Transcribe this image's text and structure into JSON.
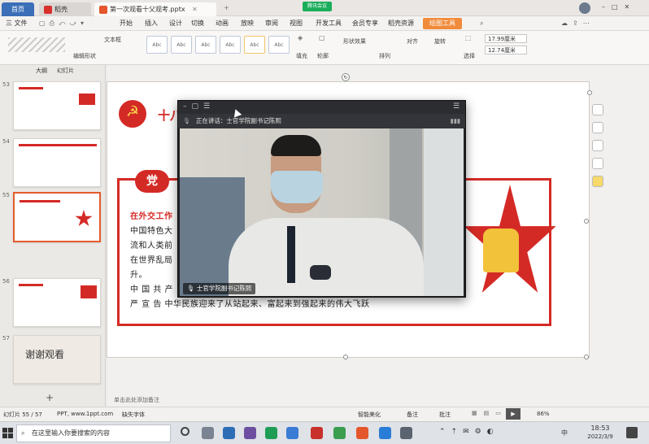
{
  "tabs": {
    "home": "首页",
    "wps": "稻壳",
    "document": "第一次观看十父观考.pptx"
  },
  "meeting_badge": "腾讯会议",
  "menu": [
    "三 文件",
    "开始",
    "插入",
    "设计",
    "切换",
    "动画",
    "放映",
    "审阅",
    "视图",
    "开发工具",
    "会员专享",
    "稻壳资源",
    "绘图工具"
  ],
  "ribbon": {
    "textbox_label": "文本框",
    "edit_shape": "编辑形状",
    "style_sample": "Abc",
    "fill": "填充",
    "outline": "轮廓",
    "shape_effect": "形状效果",
    "arrange": "排列",
    "align": "对齐",
    "rotate": "旋转",
    "select": "选择",
    "width_value": "17.99厘米",
    "height_value": "12.74厘米"
  },
  "left_panel": {
    "tab_outline": "大纲",
    "tab_slides": "幻灯片",
    "slide_numbers": [
      "53",
      "54",
      "55",
      "56",
      "57"
    ],
    "last_slide_text": "谢谢观看",
    "add_icon": "plus-icon"
  },
  "slide": {
    "partial_title": "十八",
    "badge_text": "党",
    "line1": "在外交工作",
    "line2": "中国特色大",
    "line3": "流和人类前",
    "line4": "在世界乱局",
    "line5": "升。",
    "line6": "中 国 共 产",
    "line7": "严 宣 告 中华民族迎来了从站起来、富起来到强起来的伟大飞跃"
  },
  "meeting": {
    "status": "正在讲话：士官学院副书记陈熙",
    "speaker_tag": "士官学院副书记陈熙"
  },
  "status_bar": {
    "slide_counter": "幻灯片 55 / 57",
    "template_info": "PPT, www.1ppt.com",
    "missing_font": "缺失字体",
    "notes_hint": "单击此处添加备注",
    "smart_beautify": "智能美化",
    "notes": "备注",
    "comments": "批注",
    "zoom": "86%"
  },
  "taskbar": {
    "search_placeholder": "在这里输入你要搜索的内容",
    "time": "18:53",
    "date": "2022/3/9",
    "ime": "中"
  },
  "colors": {
    "accent_red": "#d42a26",
    "wps_orange": "#f08b3b",
    "home_blue": "#3b6fb8"
  }
}
